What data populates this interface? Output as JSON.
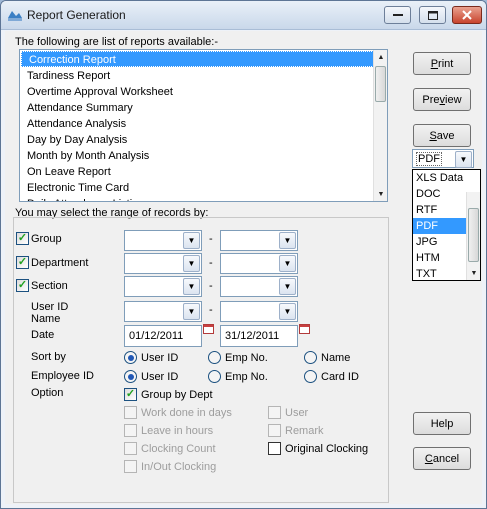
{
  "window": {
    "title": "Report Generation",
    "app_icon": "report-app-icon"
  },
  "controls": {
    "minimize": "—",
    "maximize": "□",
    "close": "✕"
  },
  "reports": {
    "caption": "The following are list of reports available:-",
    "items": [
      "Correction Report",
      "Tardiness Report",
      "Overtime Approval Worksheet",
      "Attendance Summary",
      "Attendance Analysis",
      "Day by Day Analysis",
      "Month by Month Analysis",
      "On Leave Report",
      "Electronic Time Card",
      "Daily Attendance Listing"
    ],
    "selected_index": 0
  },
  "range": {
    "caption": "You may select the range of records by:",
    "dash": "-",
    "group": {
      "label": "Group",
      "checked": true
    },
    "department": {
      "label": "Department",
      "checked": true
    },
    "section": {
      "label": "Section",
      "checked": true
    },
    "userid_name": {
      "label": "User ID\nName"
    },
    "date": {
      "label": "Date",
      "from": "01/12/2011",
      "to": "31/12/2011"
    }
  },
  "sort_by": {
    "label": "Sort by",
    "options": [
      "User ID",
      "Emp No.",
      "Name"
    ],
    "selected": "User ID"
  },
  "employee_id": {
    "label": "Employee ID",
    "options": [
      "User ID",
      "Emp No.",
      "Card ID"
    ],
    "selected": "User ID"
  },
  "option": {
    "label": "Option",
    "group_by_dept": {
      "label": "Group by Dept",
      "checked": true,
      "enabled": true
    },
    "work_done_in_days": {
      "label": "Work done in days",
      "enabled": false
    },
    "leave_in_hours": {
      "label": "Leave in hours",
      "enabled": false
    },
    "clocking_count": {
      "label": "Clocking Count",
      "enabled": false
    },
    "in_out_clocking": {
      "label": "In/Out Clocking",
      "enabled": false
    },
    "user": {
      "label": "User",
      "enabled": false
    },
    "remark": {
      "label": "Remark",
      "enabled": false
    },
    "original_clocking": {
      "label": "Original Clocking",
      "enabled": true,
      "checked": false
    }
  },
  "buttons": {
    "print": {
      "label": "Print",
      "accel": "P",
      "rest": "rint"
    },
    "preview": {
      "label": "Preview",
      "pre": "Pre",
      "accel": "v",
      "rest": "iew"
    },
    "save": {
      "label": "Save",
      "accel": "S",
      "rest": "ave"
    },
    "help": {
      "label": "Help"
    },
    "cancel": {
      "label": "Cancel",
      "accel": "C",
      "rest": "ancel"
    }
  },
  "format": {
    "selected": "PDF",
    "options": [
      "XLS Data",
      "DOC",
      "RTF",
      "PDF",
      "JPG",
      "HTM",
      "TXT"
    ]
  },
  "colors": {
    "selection": "#3399ff",
    "check_mark": "#21a121",
    "radio_dot": "#1f57b5"
  }
}
